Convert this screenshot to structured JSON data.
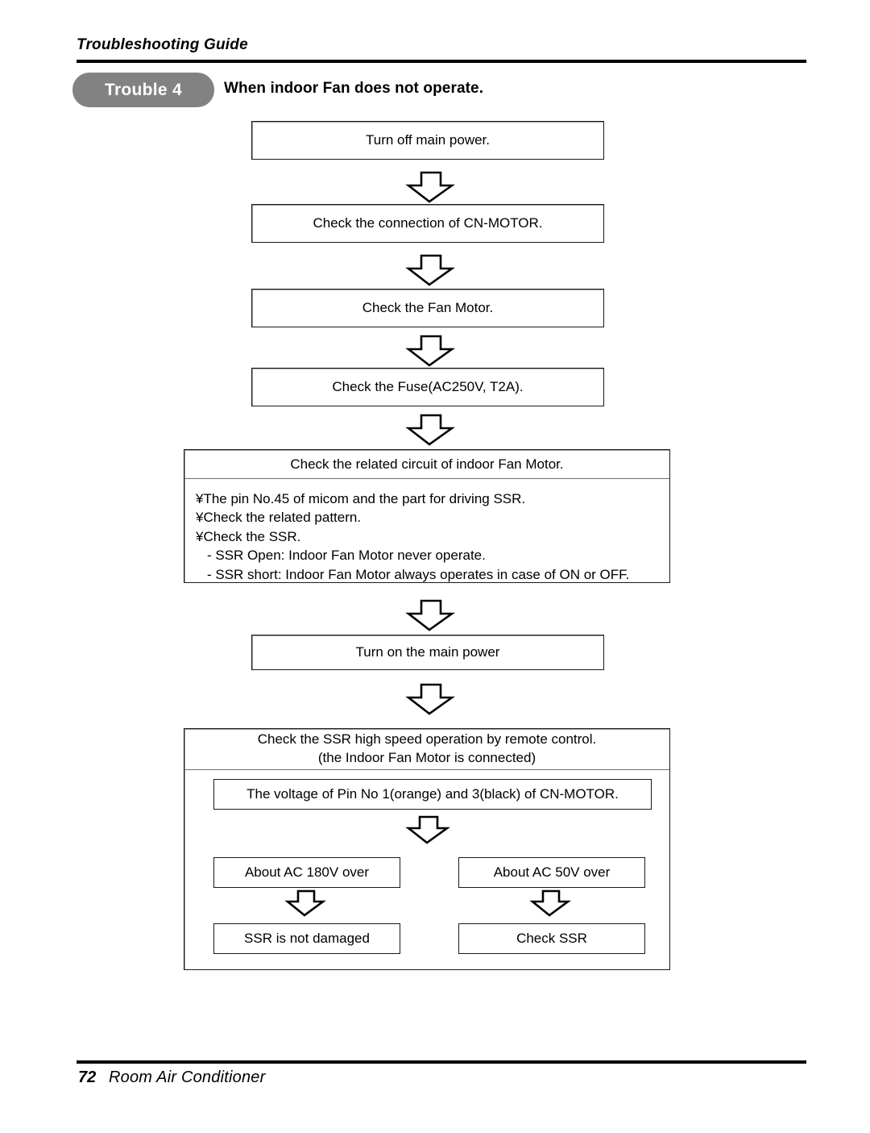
{
  "header": {
    "guide_title": "Troubleshooting Guide",
    "badge_label": "Trouble 4",
    "heading": "When indoor Fan does not operate.",
    "badge_color": "#828282"
  },
  "flow": {
    "steps": [
      {
        "label": "Turn off main power."
      },
      {
        "label": "Check the connection of CN-MOTOR."
      },
      {
        "label": "Check the Fan Motor."
      },
      {
        "label": "Check the Fuse(AC250V, T2A)."
      }
    ],
    "related_circuit": {
      "title": "Check the related circuit of indoor Fan Motor.",
      "bullets": [
        "¥The pin No.45 of micom and the part for driving SSR.",
        "¥Check the related pattern.",
        "¥Check the SSR."
      ],
      "sub_items": [
        "- SSR Open: Indoor Fan Motor never operate.",
        "- SSR short: Indoor Fan Motor always operates in case of ON or OFF."
      ]
    },
    "turn_on": {
      "label": "Turn on the main power"
    },
    "ssr_check": {
      "title_line1": "Check the SSR high speed operation by remote control.",
      "title_line2": "(the Indoor Fan Motor is connected)",
      "voltage_label": "The voltage of Pin No 1(orange) and 3(black) of CN-MOTOR.",
      "branches": {
        "left_condition": "About AC 180V over",
        "left_result": "SSR is not damaged",
        "right_condition": "About AC 50V over",
        "right_result": "Check SSR"
      }
    }
  },
  "footer": {
    "page_number": "72",
    "product": "Room Air Conditioner"
  },
  "icons": {
    "arrow_down": "down-arrow-icon"
  }
}
